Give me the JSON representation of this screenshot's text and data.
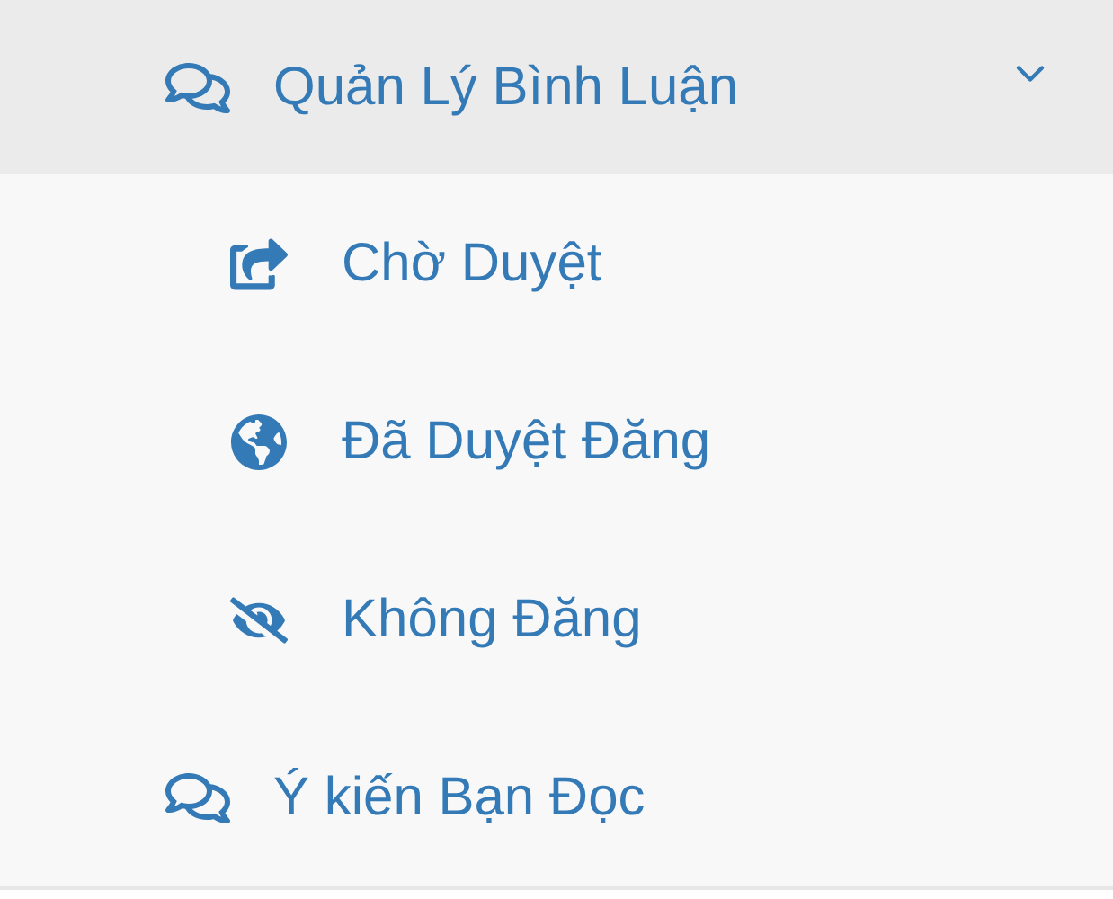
{
  "menu": [
    {
      "label": "Quản Lý Bình Luận",
      "kind": "comments",
      "expanded": true,
      "children": [
        {
          "label": "Chờ Duyệt",
          "kind": "share"
        },
        {
          "label": "Đã Duyệt Đăng",
          "kind": "globe"
        },
        {
          "label": "Không Đăng",
          "kind": "hidden"
        }
      ]
    },
    {
      "label": "Ý kiến Bạn Đọc",
      "kind": "comments",
      "expanded": false
    }
  ]
}
